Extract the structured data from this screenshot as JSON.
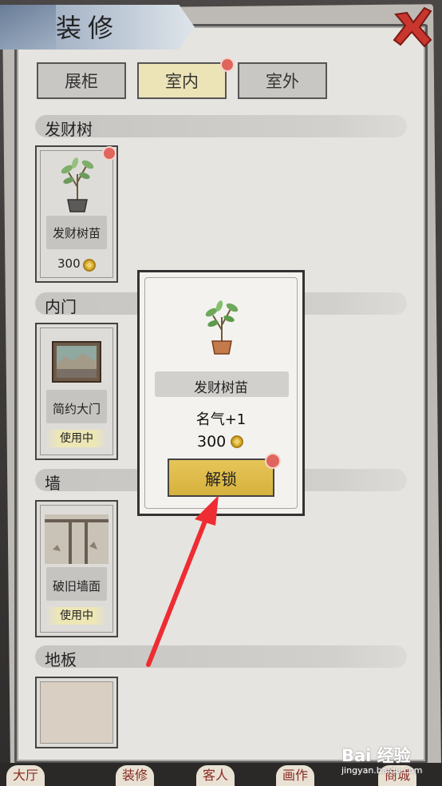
{
  "header": {
    "title": "装修"
  },
  "tabs": [
    {
      "label": "展柜",
      "active": false
    },
    {
      "label": "室内",
      "active": true,
      "badge": true
    },
    {
      "label": "室外",
      "active": false
    }
  ],
  "sections": [
    {
      "label": "发财树",
      "items": [
        {
          "name": "发财树苗",
          "price": "300",
          "badge": true
        }
      ]
    },
    {
      "label": "内门",
      "items": [
        {
          "name": "简约大门",
          "status": "使用中"
        }
      ]
    },
    {
      "label": "墙",
      "items": [
        {
          "name": "破旧墙面",
          "status": "使用中"
        }
      ]
    },
    {
      "label": "地板",
      "items": [
        {}
      ]
    }
  ],
  "popup": {
    "name": "发财树苗",
    "effect": "名气+1",
    "price": "300",
    "unlock_label": "解锁"
  },
  "bottom_nav": [
    "大厅",
    "装修",
    "客人",
    "画作",
    "商城"
  ],
  "watermark": {
    "main": "Bai 经验",
    "sub": "jingyan.baidu.com"
  },
  "colors": {
    "badge": "#e0655c",
    "active_tab": "#ece3b6",
    "unlock_button": "#d6b13d",
    "arrow": "#ee2c33",
    "coin": "#d6ac32"
  }
}
